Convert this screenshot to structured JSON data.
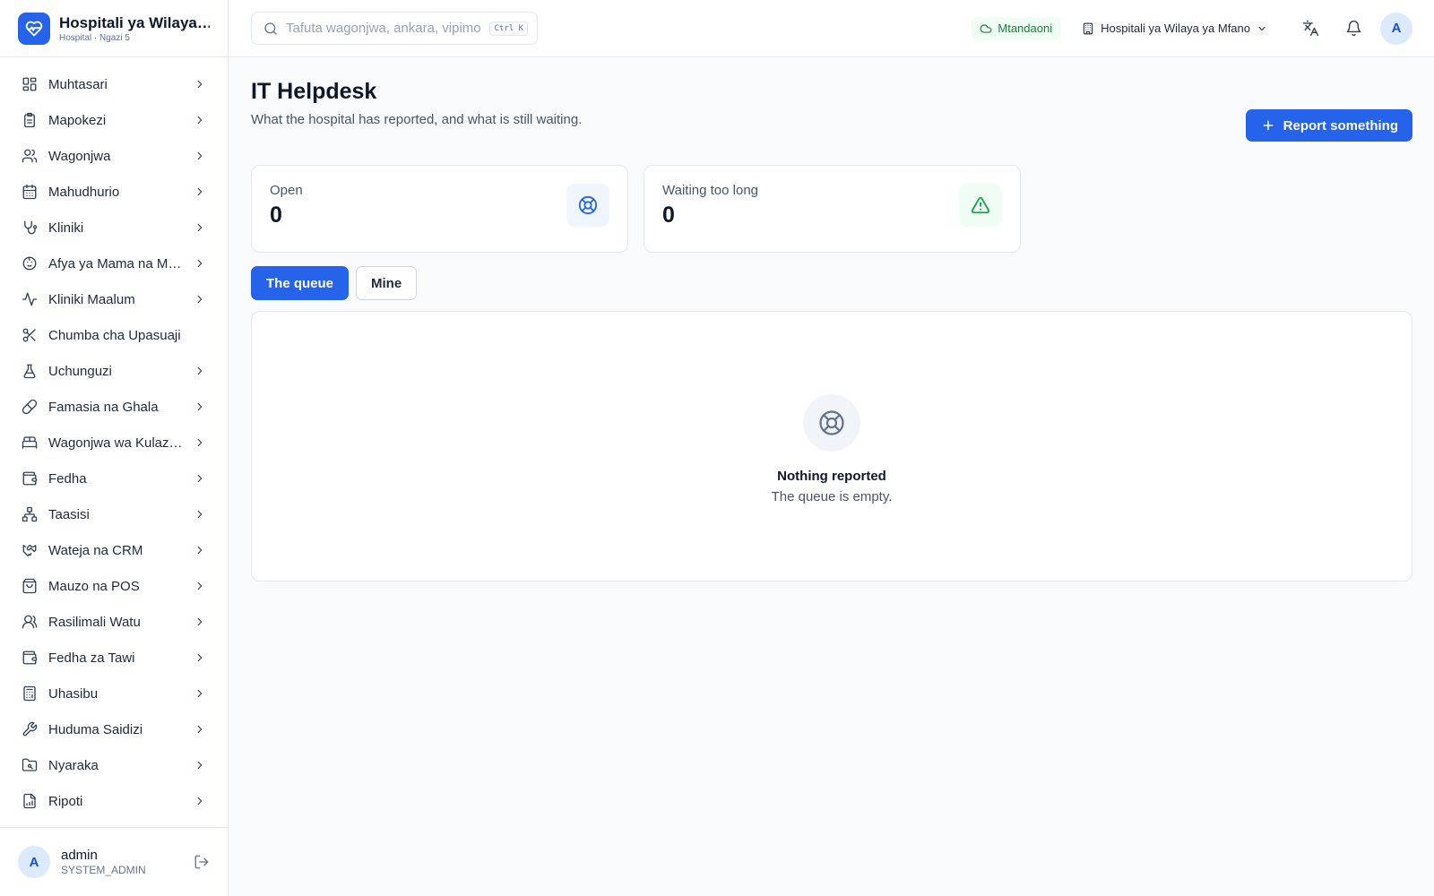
{
  "brand": {
    "name": "Hospitali ya Wilaya ya Mfano",
    "subtitle": "Hospital · Ngazi 5",
    "logo_icon": "heart-icon",
    "accent": "#2563eb"
  },
  "sidebar": {
    "items": [
      {
        "label": "Muhtasari",
        "icon": "dashboard-icon",
        "has_children": true
      },
      {
        "label": "Mapokezi",
        "icon": "clipboard-icon",
        "has_children": true
      },
      {
        "label": "Wagonjwa",
        "icon": "users-icon",
        "has_children": true
      },
      {
        "label": "Mahudhurio",
        "icon": "calendar-icon",
        "has_children": true
      },
      {
        "label": "Kliniki",
        "icon": "stethoscope-icon",
        "has_children": true
      },
      {
        "label": "Afya ya Mama na Mtoto",
        "icon": "baby-icon",
        "has_children": true
      },
      {
        "label": "Kliniki Maalum",
        "icon": "activity-icon",
        "has_children": true
      },
      {
        "label": "Chumba cha Upasuaji",
        "icon": "scissors-icon",
        "has_children": false
      },
      {
        "label": "Uchunguzi",
        "icon": "flask-icon",
        "has_children": true
      },
      {
        "label": "Famasia na Ghala",
        "icon": "pill-icon",
        "has_children": true
      },
      {
        "label": "Wagonjwa wa Kulazwa",
        "icon": "bed-icon",
        "has_children": true
      },
      {
        "label": "Fedha",
        "icon": "wallet-icon",
        "has_children": true
      },
      {
        "label": "Taasisi",
        "icon": "network-icon",
        "has_children": true
      },
      {
        "label": "Wateja na CRM",
        "icon": "handshake-icon",
        "has_children": true
      },
      {
        "label": "Mauzo na POS",
        "icon": "shopping-bag-icon",
        "has_children": true
      },
      {
        "label": "Rasilimali Watu",
        "icon": "people-icon",
        "has_children": true
      },
      {
        "label": "Fedha za Tawi",
        "icon": "wallet-icon",
        "has_children": true
      },
      {
        "label": "Uhasibu",
        "icon": "calculator-icon",
        "has_children": true
      },
      {
        "label": "Huduma Saidizi",
        "icon": "wrench-icon",
        "has_children": true
      },
      {
        "label": "Nyaraka",
        "icon": "folder-icon",
        "has_children": true
      },
      {
        "label": "Ripoti",
        "icon": "report-icon",
        "has_children": true
      }
    ]
  },
  "user": {
    "initial": "A",
    "name": "admin",
    "role": "SYSTEM_ADMIN"
  },
  "header": {
    "search_placeholder": "Tafuta wagonjwa, ankara, vipimo...",
    "search_shortcut": "Ctrl K",
    "status_label": "Mtandaoni",
    "status_color": "#15803d",
    "facility_label": "Hospitali ya Wilaya ya Mfano",
    "avatar_initial": "A"
  },
  "page": {
    "title": "IT Helpdesk",
    "subtitle": "What the hospital has reported, and what is still waiting.",
    "primary_action": "Report something"
  },
  "stats": [
    {
      "label": "Open",
      "value": "0",
      "icon": "lifebuoy-icon",
      "color": "#2563eb"
    },
    {
      "label": "Waiting too long",
      "value": "0",
      "icon": "warning-icon",
      "color": "#16a34a"
    }
  ],
  "tabs": [
    {
      "label": "The queue",
      "active": true
    },
    {
      "label": "Mine",
      "active": false
    }
  ],
  "empty_state": {
    "icon": "lifebuoy-icon",
    "title": "Nothing reported",
    "subtitle": "The queue is empty."
  }
}
